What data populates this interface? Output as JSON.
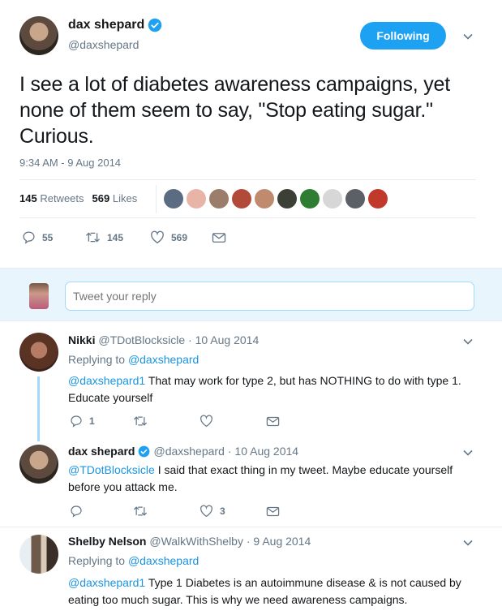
{
  "tweet": {
    "author_name": "dax shepard",
    "author_handle": "@daxshepard",
    "follow_label": "Following",
    "text": "I see a lot of diabetes awareness campaigns, yet none of them seem to say, \"Stop eating sugar.\" Curious.",
    "timestamp": "9:34 AM - 9 Aug 2014",
    "retweets_count": "145",
    "retweets_label": "Retweets",
    "likes_count": "569",
    "likes_label": "Likes",
    "actions": {
      "replies": "55",
      "retweets": "145",
      "likes": "569"
    }
  },
  "reply_box": {
    "placeholder": "Tweet your reply"
  },
  "replies": [
    {
      "name": "Nikki",
      "handle": "@TDotBlocksicle",
      "date": "· 10 Aug 2014",
      "replying_to_label": "Replying to",
      "replying_to_handle": "@daxshepard",
      "mention": "@daxshepard1",
      "text": "That may work for type 2, but has NOTHING to do with type 1. Educate yourself",
      "replies": "1",
      "retweets": "",
      "likes": ""
    },
    {
      "name": "dax shepard",
      "handle": "@daxshepard",
      "date": "· 10 Aug 2014",
      "mention": "@TDotBlocksicle",
      "text": "I said that exact thing in my tweet. Maybe educate yourself before you attack me.",
      "replies": "",
      "retweets": "",
      "likes": "3"
    },
    {
      "name": "Shelby Nelson",
      "handle": "@WalkWithShelby",
      "date": "· 9 Aug 2014",
      "replying_to_label": "Replying to",
      "replying_to_handle": "@daxshepard",
      "mention": "@daxshepard1",
      "text": "Type 1 Diabetes is an autoimmune disease & is not caused by eating too much sugar. This is why we need awareness campaigns."
    }
  ],
  "colors": {
    "accent": "#1da1f2",
    "link": "#1b95e0",
    "muted": "#657786",
    "divider": "#e6ecf0"
  },
  "icons": [
    "verified-icon",
    "chevron-down-icon",
    "reply-icon",
    "retweet-icon",
    "like-icon",
    "message-icon"
  ]
}
